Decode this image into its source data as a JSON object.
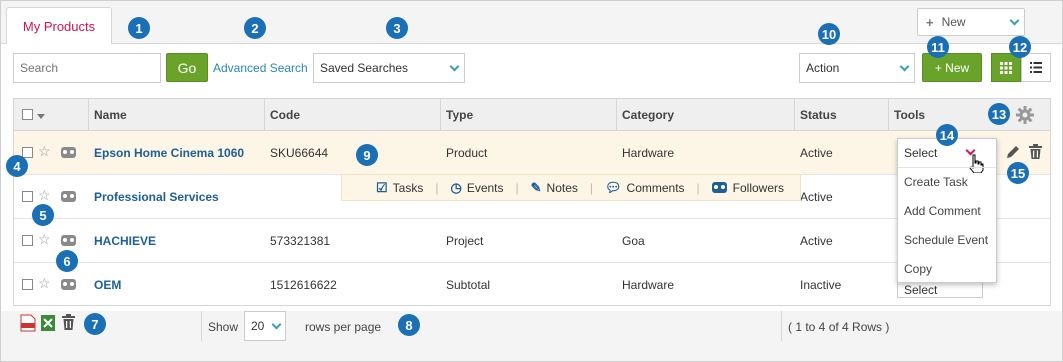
{
  "tabs": {
    "active_label": "My Products"
  },
  "top_actions": {
    "new_dropdown_label": "New"
  },
  "toolbar": {
    "search_placeholder": "Search",
    "go_label": "Go",
    "advanced_search_label": "Advanced Search",
    "saved_searches_value": "Saved Searches",
    "action_value": "Action",
    "new_button_label": "+ New"
  },
  "grid": {
    "columns": [
      "Name",
      "Code",
      "Type",
      "Category",
      "Status",
      "Tools"
    ],
    "rows": [
      {
        "name": "Epson Home Cinema 1060",
        "code": "SKU66644",
        "type": "Product",
        "category": "Hardware",
        "status": "Active"
      },
      {
        "name": "Professional Services",
        "code": "",
        "type": "",
        "category": "",
        "status": "Active"
      },
      {
        "name": "HACHIEVE",
        "code": "573321381",
        "type": "Project",
        "category": "Goa",
        "status": "Active"
      },
      {
        "name": "OEM",
        "code": "1512616622",
        "type": "Subtotal",
        "category": "Hardware",
        "status": "Inactive"
      }
    ],
    "row_actions": [
      "Tasks",
      "Events",
      "Notes",
      "Comments",
      "Followers"
    ],
    "tools_select_value": "Select",
    "tools_menu": [
      "Create Task",
      "Add Comment",
      "Schedule Event",
      "Copy"
    ]
  },
  "footer": {
    "show_label": "Show",
    "page_size": "20",
    "rows_per_page_label": "rows per page",
    "rows_summary": "( 1 to 4 of 4 Rows )"
  },
  "badges": [
    "1",
    "2",
    "3",
    "4",
    "5",
    "6",
    "7",
    "8",
    "9",
    "10",
    "11",
    "12",
    "13",
    "14",
    "15"
  ],
  "colors": {
    "accent_green": "#6aa329",
    "badge_blue": "#1a6fb5",
    "link_blue": "#2a86b9",
    "tab_red": "#d0154f",
    "highlight_row": "#fdf5e6"
  }
}
